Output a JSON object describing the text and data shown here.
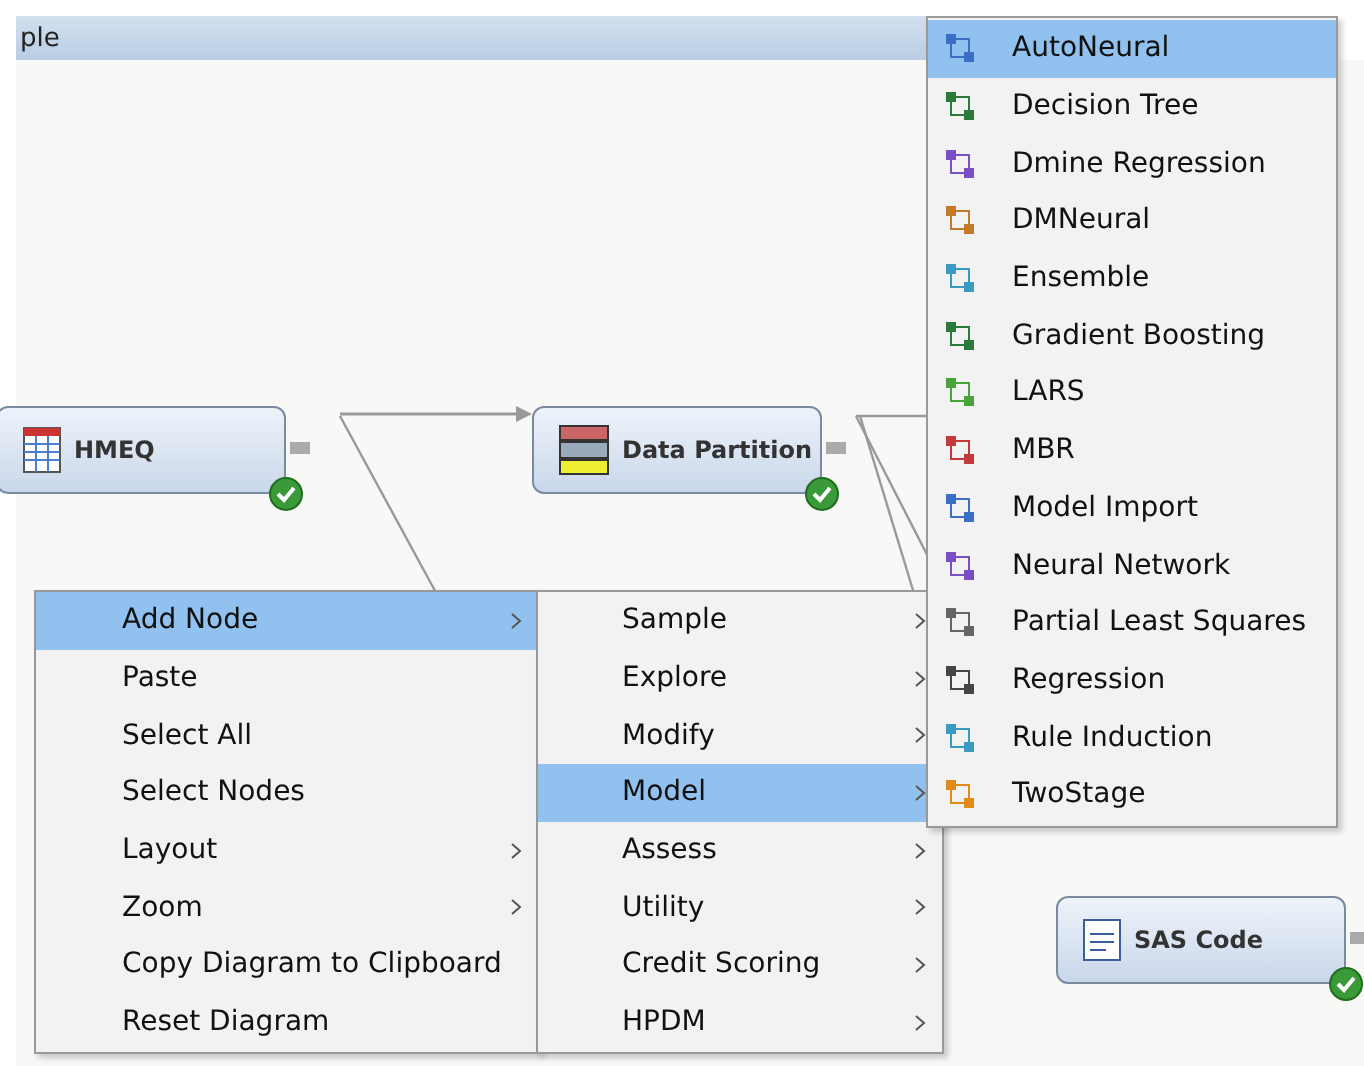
{
  "window": {
    "title": "ple"
  },
  "nodes": [
    {
      "label": "HMEQ",
      "complete": true
    },
    {
      "label": "Data Partition",
      "complete": true
    },
    {
      "label": "SAS Code",
      "complete": true
    }
  ],
  "context_menu": [
    {
      "label": "Add Node",
      "has_submenu": true,
      "selected": true
    },
    {
      "label": "Paste",
      "has_submenu": false,
      "selected": false
    },
    {
      "label": "Select All",
      "has_submenu": false,
      "selected": false
    },
    {
      "label": "Select Nodes",
      "has_submenu": false,
      "selected": false
    },
    {
      "label": "Layout",
      "has_submenu": true,
      "selected": false
    },
    {
      "label": "Zoom",
      "has_submenu": true,
      "selected": false
    },
    {
      "label": "Copy Diagram to Clipboard",
      "has_submenu": false,
      "selected": false
    },
    {
      "label": "Reset Diagram",
      "has_submenu": false,
      "selected": false
    }
  ],
  "add_node_menu": [
    {
      "label": "Sample",
      "has_submenu": true,
      "selected": false
    },
    {
      "label": "Explore",
      "has_submenu": true,
      "selected": false
    },
    {
      "label": "Modify",
      "has_submenu": true,
      "selected": false
    },
    {
      "label": "Model",
      "has_submenu": true,
      "selected": true
    },
    {
      "label": "Assess",
      "has_submenu": true,
      "selected": false
    },
    {
      "label": "Utility",
      "has_submenu": true,
      "selected": false
    },
    {
      "label": "Credit Scoring",
      "has_submenu": true,
      "selected": false
    },
    {
      "label": "HPDM",
      "has_submenu": true,
      "selected": false
    }
  ],
  "model_menu": [
    {
      "label": "AutoNeural",
      "selected": true
    },
    {
      "label": "Decision Tree",
      "selected": false
    },
    {
      "label": "Dmine Regression",
      "selected": false
    },
    {
      "label": "DMNeural",
      "selected": false
    },
    {
      "label": "Ensemble",
      "selected": false
    },
    {
      "label": "Gradient Boosting",
      "selected": false
    },
    {
      "label": "LARS",
      "selected": false
    },
    {
      "label": "MBR",
      "selected": false
    },
    {
      "label": "Model Import",
      "selected": false
    },
    {
      "label": "Neural Network",
      "selected": false
    },
    {
      "label": "Partial Least Squares",
      "selected": false
    },
    {
      "label": "Regression",
      "selected": false
    },
    {
      "label": "Rule Induction",
      "selected": false
    },
    {
      "label": "TwoStage",
      "selected": false
    }
  ]
}
